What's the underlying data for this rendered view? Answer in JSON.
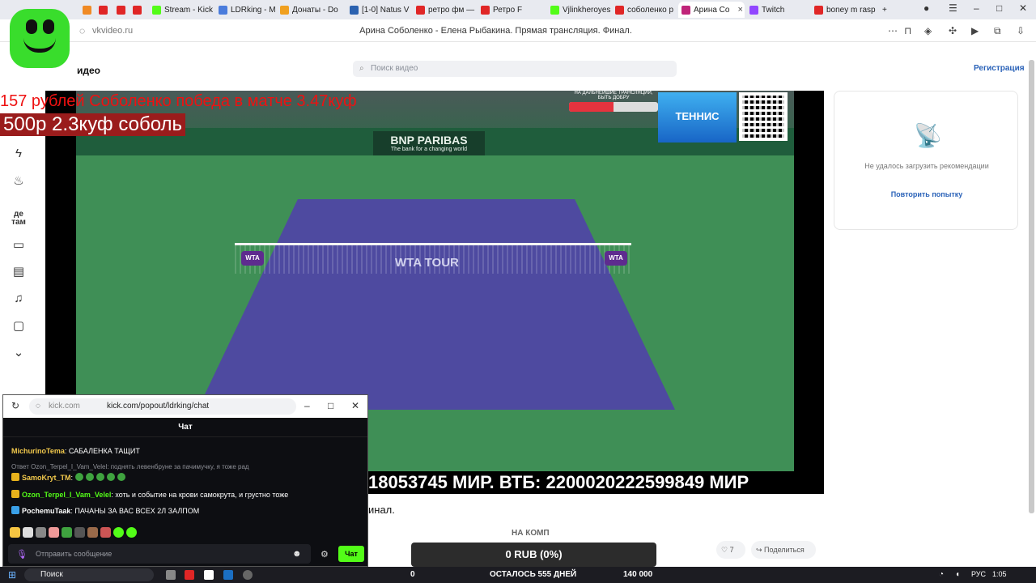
{
  "browser": {
    "tabs": [
      {
        "label": "",
        "color": "#f08a24"
      },
      {
        "label": "",
        "color": "#e02626"
      },
      {
        "label": "",
        "color": "#e02626"
      },
      {
        "label": "",
        "color": "#e02626"
      },
      {
        "label": "Stream - Kick",
        "color": "#53fc18"
      },
      {
        "label": "LDRking - Me",
        "color": "#4a7cdc"
      },
      {
        "label": "Донаты - Do",
        "color": "#f0a020"
      },
      {
        "label": "[1-0] Natus V",
        "color": "#2b62b0"
      },
      {
        "label": "ретро фм —",
        "color": "#e02626"
      },
      {
        "label": "Ретро F",
        "color": "#e02626"
      },
      {
        "label": "Vjlinkheroyes",
        "color": "#53fc18"
      },
      {
        "label": "соболенко р",
        "color": "#e02626"
      },
      {
        "label": "Арина Со",
        "color": "#c0247a",
        "active": true
      },
      {
        "label": "Twitch",
        "color": "#9146ff"
      },
      {
        "label": "boney m rasp",
        "color": "#e02626"
      }
    ],
    "new_tab": "+",
    "url": "vkvideo.ru",
    "page_title": "Арина Соболенко - Елена Рыбакина. Прямая трансляция. Финал."
  },
  "site": {
    "logo_text": "идео",
    "search_placeholder": "Поиск видео",
    "register": "Регистрация"
  },
  "video": {
    "overlay_line1": "157 рублей Соболенко победа в матче 3.47куф",
    "overlay_line2": "500р 2.3куф соболь",
    "ticker": "18053745 МИР. ВТБ: 2200020222599849 МИР",
    "progress_caption": "НА ДАЛЬНЕЙШИЕ ТРАНСЛЯЦИИ, БЫТЬ ДОБРУ",
    "progress_fill": 0.5,
    "tennis_badge": "ТЕННИС",
    "sponsor_main": "BNP PARIBAS",
    "sponsor_tag": "The bank for a changing world",
    "wta": "WTA",
    "wta_tour": "WTA TOUR"
  },
  "recommendations": {
    "error": "Не удалось загрузить рекомендации",
    "retry": "Повторить попытку"
  },
  "below": {
    "description_tail": "инал.",
    "on_comp": "НА КОМП",
    "rub": "0 RUB (0%)",
    "likes": "7",
    "share": "Поделиться"
  },
  "kick": {
    "url_domain": "kick.com",
    "url_path": "kick.com/popout/ldrking/chat",
    "chat_title": "Чат",
    "messages": [
      {
        "user": "MichurinoTema",
        "user_color": "#f2c94c",
        "text": "САБАЛЕНКА ТАЩИТ",
        "badge": ""
      },
      {
        "reply": "Ответ Ozon_Terpel_I_Vam_Velel: поднять левенбруне за пачимучку, я тоже рад"
      },
      {
        "user": "SamoKryt_TM",
        "user_color": "#f2c94c",
        "text": "",
        "badge": "#e8b21c"
      },
      {
        "user": "Ozon_Terpel_I_Vam_Velel",
        "user_color": "#53fc18",
        "text": "хоть и событие на крови самокрута, и грустно тоже",
        "badge": "#e8b21c"
      },
      {
        "user": "PochemuTaak",
        "user_color": "#ffffff",
        "text": "ПАЧАНЫ ЗА ВАС ВСЕХ 2Л ЗАЛПОМ",
        "badge": "#3aa0e8"
      }
    ],
    "input_placeholder": "Отправить сообщение",
    "send": "Чат"
  },
  "taskbar": {
    "search": "Поиск",
    "counter_left": "0",
    "countdown": "ОСТАЛОСЬ 555 ДНЕЙ",
    "counter_right": "140 000",
    "lang": "РУС",
    "time": "1:05"
  },
  "colors": {
    "kick_green": "#53fc18",
    "vk_blue": "#2a62b8",
    "court_blue": "#4e4aa0",
    "court_green": "#3f8f56"
  }
}
